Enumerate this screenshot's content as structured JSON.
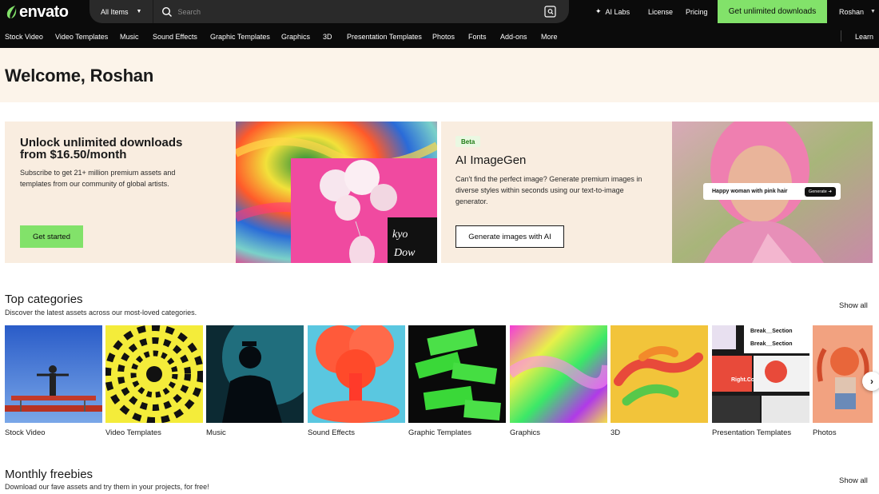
{
  "header": {
    "logo_text": "envato",
    "all_items_label": "All Items",
    "search_placeholder": "Search",
    "ai_labs": "AI Labs",
    "license": "License",
    "pricing": "Pricing",
    "cta": "Get unlimited downloads",
    "user": "Roshan"
  },
  "catnav": {
    "items": [
      "Stock Video",
      "Video Templates",
      "Music",
      "Sound Effects",
      "Graphic Templates",
      "Graphics",
      "3D",
      "Presentation Templates",
      "Photos",
      "Fonts",
      "Add-ons",
      "More"
    ],
    "learn": "Learn"
  },
  "welcome": {
    "title": "Welcome, Roshan"
  },
  "promo_unlimited": {
    "title": "Unlock unlimited downloads from $16.50/month",
    "body": "Subscribe to get 21+ million premium assets and templates from our community of global artists.",
    "button": "Get started"
  },
  "promo_ai": {
    "badge": "Beta",
    "title": "AI ImageGen",
    "body": "Can't find the perfect image? Generate premium images in diverse styles within seconds using our text-to-image generator.",
    "button": "Generate images with AI",
    "prompt_text": "Happy woman with pink hair",
    "prompt_button": "Generate"
  },
  "top_categories": {
    "title": "Top categories",
    "subtitle": "Discover the latest assets across our most-loved categories.",
    "show_all": "Show all",
    "items": [
      "Stock Video",
      "Video Templates",
      "Music",
      "Sound Effects",
      "Graphic Templates",
      "Graphics",
      "3D",
      "Presentation Templates",
      "Photos"
    ],
    "tile_texts": [
      "Break__Section",
      "Break__Section",
      "Right.Co"
    ]
  },
  "monthly_freebies": {
    "title": "Monthly freebies",
    "subtitle": "Download our fave assets and try them in your projects, for free!",
    "show_all": "Show all"
  },
  "colors": {
    "accent_green": "#82e26a",
    "nav_bg": "#0b0b0b",
    "cream": "#fcf4ea"
  }
}
